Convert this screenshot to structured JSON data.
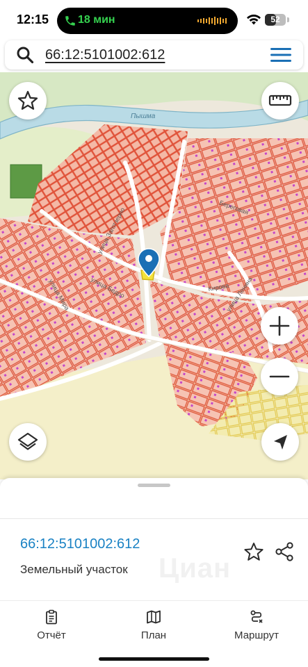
{
  "status_bar": {
    "time": "12:15",
    "call_duration": "18 мин",
    "battery_level": "52",
    "battery_fraction": 0.52
  },
  "search": {
    "query": "66:12:5101002:612"
  },
  "map": {
    "river_name": "Пышма",
    "street_labels": [
      "улица Заготзерно",
      "улица Бедро",
      "улица Мира",
      "Береговая",
      "улица Ленина",
      "Кирова"
    ],
    "parcel_outline_color": "#e0533a",
    "parcel_fill_color": "#f4b9a6",
    "marker_color": "#1a6fb5",
    "river_color": "#b9dbe6",
    "forest_color": "#cfe5b6"
  },
  "icons": {
    "search": "search-icon",
    "menu": "hamburger-menu-icon",
    "favorite": "star-icon",
    "ruler": "ruler-icon",
    "zoom_in": "plus-icon",
    "zoom_out": "minus-icon",
    "layers": "layers-icon",
    "location": "navigation-arrow-icon",
    "share": "share-icon",
    "report": "clipboard-icon",
    "plan": "map-book-icon",
    "route": "route-icon"
  },
  "sheet": {
    "parcel_id": "66:12:5101002:612",
    "parcel_type": "Земельный участок",
    "watermark": "Циан"
  },
  "tabs": [
    {
      "label": "Отчёт"
    },
    {
      "label": "План"
    },
    {
      "label": "Маршрут"
    }
  ],
  "accent_color": "#1a82c4"
}
